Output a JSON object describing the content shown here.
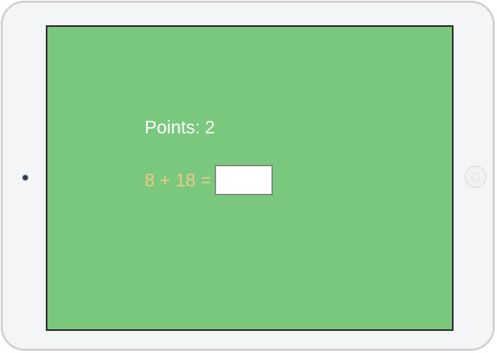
{
  "device": {
    "frame_color": "#f4f5f6",
    "camera_icon": "camera-dot-icon",
    "home_icon": "home-button-icon"
  },
  "game": {
    "background_color": "#7ac87e",
    "points_label": "Points:",
    "points_value": "2",
    "equation": "8 + 18 =",
    "equation_color": "#f3c98c",
    "answer_value": "",
    "answer_placeholder": ""
  }
}
